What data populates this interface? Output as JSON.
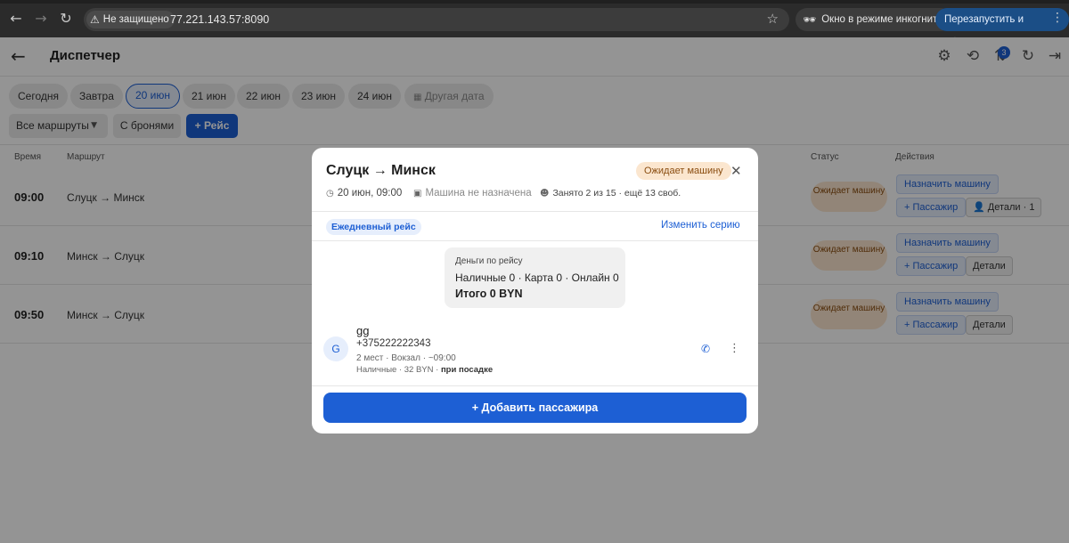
{
  "browser": {
    "security_label": "Не защищено",
    "url": "77.221.143.57:8090",
    "incognito_label": "Окно в режиме инкогнито",
    "relaunch_label": "Перезапустить и обновить"
  },
  "app": {
    "title": "Диспетчер",
    "notification_count": "3"
  },
  "dates": [
    "Сегодня",
    "Завтра",
    "20 июн",
    "21 июн",
    "22 июн",
    "23 июн",
    "24 июн"
  ],
  "dates_active": "20 июн",
  "other_date": "Другая дата",
  "filters": {
    "routes_select": "Все маршруты",
    "with_bookings": "С бронями",
    "add_trip": "+ Рейс"
  },
  "table": {
    "headers": {
      "time": "Время",
      "route": "Маршрут",
      "status": "Статус",
      "actions": "Действия"
    },
    "rows": [
      {
        "time": "09:00",
        "route": "Слуцк → Минск",
        "status": "Ожидает машину",
        "assign": "Назначить машину",
        "add_passenger": "+ Пассажир",
        "details": "👤 Детали · 1"
      },
      {
        "time": "09:10",
        "route": "Минск → Слуцк",
        "status": "Ожидает машину",
        "assign": "Назначить машину",
        "add_passenger": "+ Пассажир",
        "details": "Детали"
      },
      {
        "time": "09:50",
        "route": "Минск → Слуцк",
        "status": "Ожидает машину",
        "assign": "Назначить машину",
        "add_passenger": "+ Пассажир",
        "details": "Детали"
      }
    ]
  },
  "modal": {
    "title": "Слуцк → Минск",
    "status_badge": "Ожидает машину",
    "datetime": "20 июн, 09:00",
    "vehicle": "Машина не назначена",
    "occupancy": "Занято 2 из 15 · ещё 13 своб.",
    "daily_badge": "Ежедневный рейс",
    "change_series": "Изменить серию",
    "money": {
      "header": "Деньги по рейсу",
      "breakdown": "Наличные 0 · Карта 0 · Онлайн 0",
      "total": "Итого 0 BYN"
    },
    "passenger": {
      "avatar_letter": "G",
      "name": "gg",
      "phone": "+375222222343",
      "info": "2 мест · Вокзал · ~09:00",
      "payment": "Наличные · 32 BYN · ",
      "payment_when": "при посадке"
    },
    "add_passenger": "+ Добавить пассажира"
  },
  "colors": {
    "accent": "#1d5fd4",
    "status_bg": "#fbe6cf",
    "status_text": "#8a4d10"
  },
  "icons": [
    "back-icon",
    "forward-icon",
    "reload-icon",
    "warning-icon",
    "star-icon",
    "incognito-icon",
    "arrow-left-icon",
    "gear-icon",
    "history-icon",
    "transfer-icon",
    "refresh-icon",
    "logout-icon",
    "calendar-icon",
    "clock-icon",
    "bus-icon",
    "people-icon",
    "close-icon",
    "phone-icon",
    "more-vert-icon"
  ]
}
